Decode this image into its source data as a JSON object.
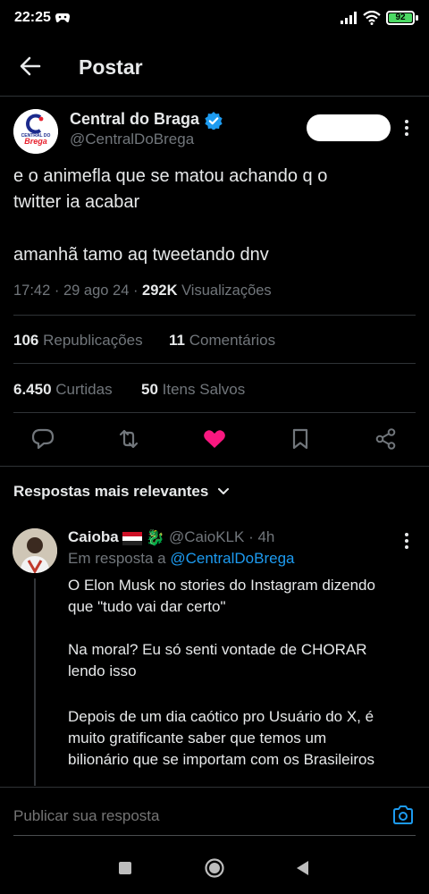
{
  "status": {
    "time": "22:25",
    "battery": "92"
  },
  "header": {
    "title": "Postar"
  },
  "post": {
    "author_name": "Central do Braga",
    "author_handle": "@CentralDoBrega",
    "avatar_text_top": "CENTRAL DO",
    "avatar_text_bottom": "Brega",
    "text_line1": "e o animefla que se matou achando q o",
    "text_line2": "twitter ia acabar",
    "text_line3": "amanhã tamo aq tweetando dnv",
    "time": "17:42",
    "date": "29 ago 24",
    "views_count": "292K",
    "views_label": "Visualizações",
    "reposts_count": "106",
    "reposts_label": "Republicações",
    "comments_count": "11",
    "comments_label": "Comentários",
    "likes_count": "6.450",
    "likes_label": "Curtidas",
    "saves_count": "50",
    "saves_label": "Itens Salvos",
    "liked": true,
    "like_color": "#f91880"
  },
  "replies_section": {
    "sort_label": "Respostas mais relevantes"
  },
  "reply": {
    "name": "Caioba",
    "handle": "@CaioKLK",
    "time_ago": "4h",
    "in_reply_prefix": "Em resposta a",
    "in_reply_handle": "@CentralDoBrega",
    "line1": "O Elon Musk no stories do Instagram dizendo",
    "line2": "que \"tudo vai dar certo\"",
    "line3": "Na moral? Eu só senti vontade de CHORAR",
    "line4": "lendo isso",
    "line5": "Depois de um dia caótico pro Usuário do X, é",
    "line6": "muito gratificante saber que temos um",
    "line7": "bilionário que se importam com os Brasileiros"
  },
  "composer": {
    "placeholder": "Publicar sua resposta"
  },
  "colors": {
    "accent": "#1d9bf0",
    "background": "#000000",
    "muted": "#71767b"
  }
}
